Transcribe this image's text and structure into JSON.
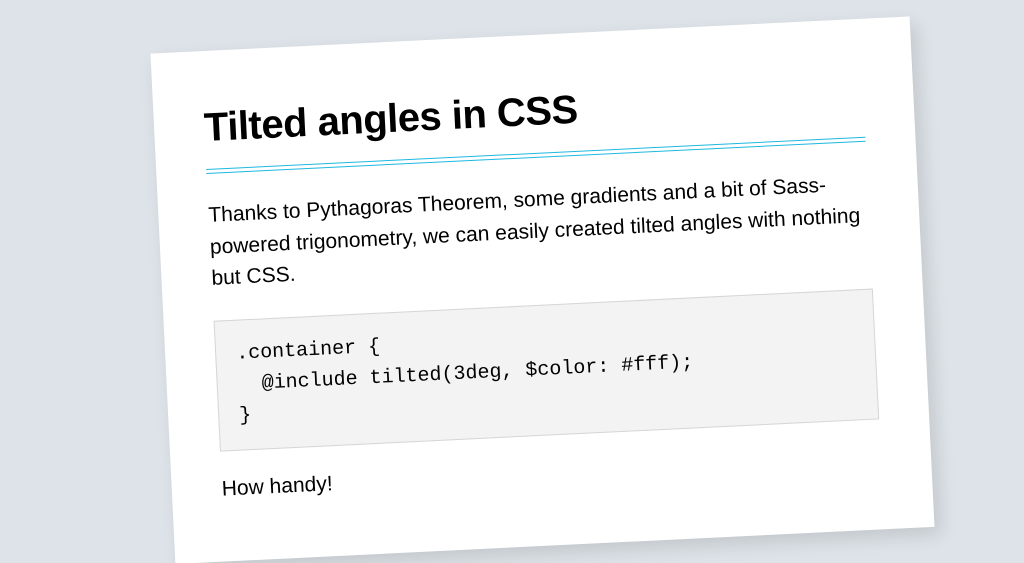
{
  "article": {
    "title": "Tilted angles in CSS",
    "intro": "Thanks to Pythagoras Theorem, some gradients and a bit of Sass-powered trigonometry, we can easily created tilted angles with nothing but CSS.",
    "code": ".container {\n  @include tilted(3deg, $color: #fff);\n}",
    "outro": "How handy!"
  }
}
